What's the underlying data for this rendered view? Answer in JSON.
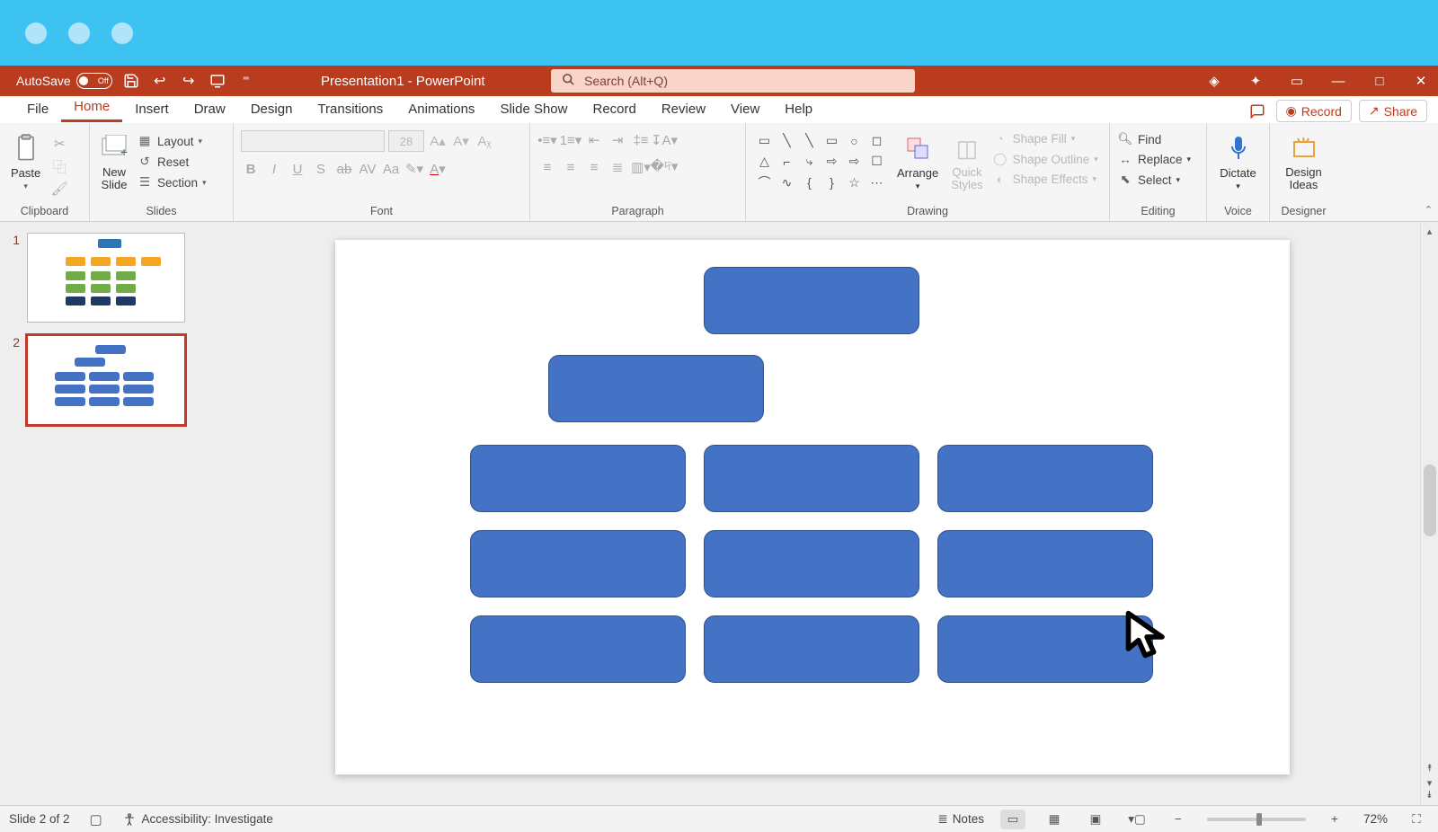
{
  "titlebar": {
    "autosave_label": "AutoSave",
    "autosave_state": "Off",
    "document_title": "Presentation1 - PowerPoint",
    "search_placeholder": "Search (Alt+Q)"
  },
  "tabs": {
    "file": "File",
    "home": "Home",
    "insert": "Insert",
    "draw": "Draw",
    "design": "Design",
    "transitions": "Transitions",
    "animations": "Animations",
    "slideshow": "Slide Show",
    "record_tab": "Record",
    "review": "Review",
    "view": "View",
    "help": "Help",
    "record_btn": "Record",
    "share_btn": "Share"
  },
  "ribbon": {
    "clipboard": {
      "label": "Clipboard",
      "paste": "Paste"
    },
    "slides": {
      "label": "Slides",
      "new_slide": "New\nSlide",
      "layout": "Layout",
      "reset": "Reset",
      "section": "Section"
    },
    "font": {
      "label": "Font",
      "size": "28"
    },
    "paragraph": {
      "label": "Paragraph"
    },
    "drawing": {
      "label": "Drawing",
      "arrange": "Arrange",
      "quick_styles": "Quick\nStyles",
      "shape_fill": "Shape Fill",
      "shape_outline": "Shape Outline",
      "shape_effects": "Shape Effects"
    },
    "editing": {
      "label": "Editing",
      "find": "Find",
      "replace": "Replace",
      "select": "Select"
    },
    "voice": {
      "label": "Voice",
      "dictate": "Dictate"
    },
    "designer": {
      "label": "Designer",
      "design_ideas": "Design\nIdeas"
    }
  },
  "thumbnails": {
    "one": "1",
    "two": "2"
  },
  "statusbar": {
    "slide_info": "Slide 2 of 2",
    "accessibility": "Accessibility: Investigate",
    "notes": "Notes",
    "zoom": "72%"
  }
}
